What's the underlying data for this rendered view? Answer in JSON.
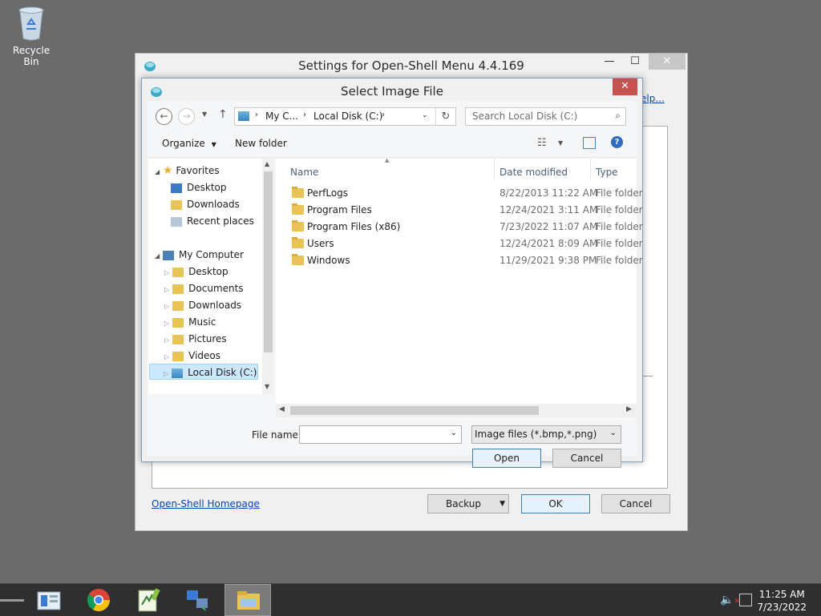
{
  "desktop": {
    "recycle_bin_label": "Recycle Bin"
  },
  "settings_window": {
    "title": "Settings for Open-Shell Menu 4.4.169",
    "help_link": "elp...",
    "homepage_link": "Open-Shell Homepage",
    "backup_label": "Backup",
    "ok_label": "OK",
    "cancel_label": "Cancel"
  },
  "dialog": {
    "title": "Select Image File",
    "close_glyph": "✕",
    "breadcrumb": {
      "part1": "My C...",
      "part2": "Local Disk (C:)"
    },
    "search_placeholder": "Search Local Disk (C:)",
    "toolbar": {
      "organize": "Organize",
      "new_folder": "New folder"
    },
    "nav": {
      "favorites": "Favorites",
      "favorites_items": [
        "Desktop",
        "Downloads",
        "Recent places"
      ],
      "my_computer": "My Computer",
      "computer_items": [
        "Desktop",
        "Documents",
        "Downloads",
        "Music",
        "Pictures",
        "Videos",
        "Local Disk (C:)"
      ]
    },
    "columns": {
      "name": "Name",
      "date": "Date modified",
      "type": "Type"
    },
    "files": [
      {
        "name": "PerfLogs",
        "date": "8/22/2013 11:22 AM",
        "type": "File folder"
      },
      {
        "name": "Program Files",
        "date": "12/24/2021 3:11 AM",
        "type": "File folder"
      },
      {
        "name": "Program Files (x86)",
        "date": "7/23/2022 11:07 AM",
        "type": "File folder"
      },
      {
        "name": "Users",
        "date": "12/24/2021 8:09 AM",
        "type": "File folder"
      },
      {
        "name": "Windows",
        "date": "11/29/2021 9:38 PM",
        "type": "File folder"
      }
    ],
    "filename_label": "File name:",
    "filename_value": "",
    "filetype_value": "Image files (*.bmp,*.png)",
    "open_label": "Open",
    "cancel_label": "Cancel"
  },
  "taskbar": {
    "time": "11:25 AM",
    "date": "7/23/2022"
  }
}
